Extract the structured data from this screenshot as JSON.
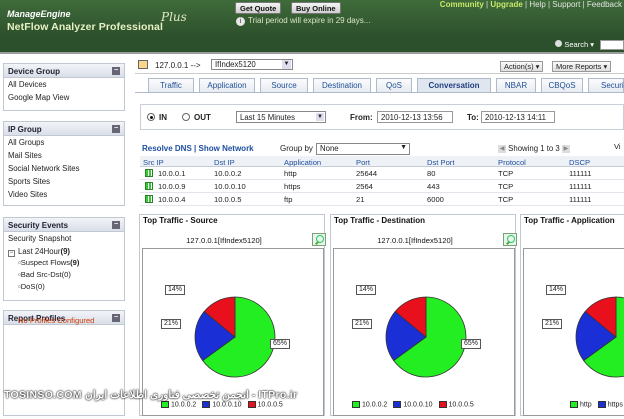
{
  "header": {
    "brand_small": "ManageEngine",
    "brand": "NetFlow Analyzer Professional",
    "edition": "Plus",
    "get_quote": "Get Quote",
    "buy_online": "Buy Online",
    "trial": "Trial period will expire in 29 days...",
    "links": [
      "Community",
      "Upgrade",
      "Help",
      "Support",
      "Feedback"
    ],
    "search_label": "Search"
  },
  "sidebar": {
    "device_group": {
      "title": "Device Group",
      "items": [
        "All Devices",
        "Google Map View"
      ]
    },
    "ip_group": {
      "title": "IP Group",
      "items": [
        "All Groups",
        "Mail Sites",
        "Social Network Sites",
        "Sports Sites",
        "Video Sites"
      ]
    },
    "security": {
      "title": "Security Events",
      "snapshot": "Security Snapshot",
      "last24": "Last 24Hour",
      "last24_count": "(9)",
      "subs": [
        {
          "label": "Suspect Flows",
          "count": "(9)"
        },
        {
          "label": "Bad Src-Dst(0)",
          "count": ""
        },
        {
          "label": "DoS(0)",
          "count": ""
        }
      ]
    },
    "reports": {
      "title": "Report Profiles",
      "empty": "No Profiles Configured"
    }
  },
  "breadcrumb": {
    "ip": "127.0.0.1 -->",
    "interface": "IfIndex5120",
    "actions": "Action(s)",
    "more_reports": "More Reports"
  },
  "tabs": [
    "Traffic",
    "Application",
    "Source",
    "Destination",
    "QoS",
    "Conversation",
    "NBAR",
    "CBQoS",
    "Securi"
  ],
  "active_tab": "Conversation",
  "filters": {
    "in_label": "IN",
    "out_label": "OUT",
    "period": "Last 15 Minutes",
    "from_label": "From:",
    "from_value": "2010-12-13 13:56",
    "to_label": "To:",
    "to_value": "2010-12-13 14:11"
  },
  "table_tools": {
    "resolve_dns": "Resolve DNS",
    "separator": "|",
    "show_network": "Show Network",
    "group_by_label": "Group by",
    "group_by_value": "None",
    "paging": "Showing 1 to 3",
    "view": "Vi"
  },
  "table": {
    "columns": [
      "Src IP",
      "Dst IP",
      "Application",
      "Port",
      "Dst Port",
      "Protocol",
      "DSCP"
    ],
    "rows": [
      [
        "10.0.0.1",
        "10.0.0.2",
        "http",
        "25644",
        "80",
        "TCP",
        "111111"
      ],
      [
        "10.0.0.9",
        "10.0.0.10",
        "https",
        "2564",
        "443",
        "TCP",
        "111111"
      ],
      [
        "10.0.0.4",
        "10.0.0.5",
        "ftp",
        "21",
        "6000",
        "TCP",
        "111111"
      ]
    ]
  },
  "charts": [
    {
      "title": "Top Traffic - Source",
      "subtitle": "127.0.0.1[IfIndex5120]",
      "labels": [
        "14%",
        "21%",
        "65%"
      ]
    },
    {
      "title": "Top Traffic - Destination",
      "subtitle": "127.0.0.1[IfIndex5120]",
      "labels": [
        "14%",
        "21%",
        "65%"
      ]
    },
    {
      "title": "Top Traffic - Application",
      "subtitle": "127.0.0.1[IfIndex5120]",
      "labels": [
        "14%",
        "21%"
      ]
    }
  ],
  "chart_data": [
    {
      "type": "pie",
      "title": "Top Traffic - Source",
      "labels": [
        "10.0.0.2",
        "10.0.0.10",
        "10.0.0.5"
      ],
      "values": [
        65,
        21,
        14
      ],
      "colors": [
        "#22ee22",
        "#1b2fd6",
        "#e8101c"
      ]
    },
    {
      "type": "pie",
      "title": "Top Traffic - Destination",
      "labels": [
        "10.0.0.2",
        "10.0.0.10",
        "10.0.0.5"
      ],
      "values": [
        65,
        21,
        14
      ],
      "colors": [
        "#22ee22",
        "#1b2fd6",
        "#e8101c"
      ]
    },
    {
      "type": "pie",
      "title": "Top Traffic - Application",
      "labels": [
        "http",
        "https"
      ],
      "values": [
        65,
        21,
        14
      ],
      "colors": [
        "#22ee22",
        "#1b2fd6",
        "#e8101c"
      ]
    }
  ],
  "legends": [
    [
      "10.0.0.2",
      "10.0.0.10",
      "10.0.0.5"
    ],
    [
      "10.0.0.2",
      "10.0.0.10",
      "10.0.0.5"
    ],
    [
      "http",
      "https"
    ]
  ],
  "watermark": "TOSINSO.COM انجمن تخصصی فناوری اطلاعات ایران - ITPro.ir"
}
